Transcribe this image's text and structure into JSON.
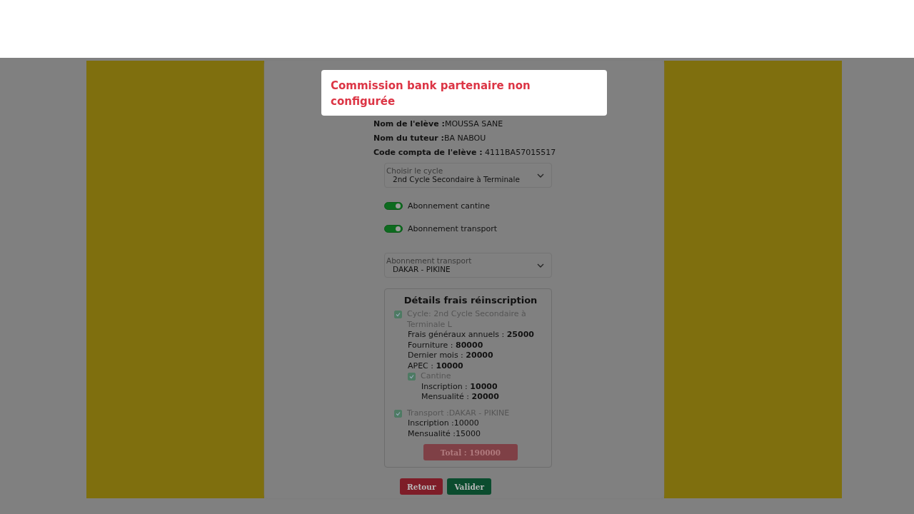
{
  "toast": {
    "message": "Commission bank partenaire non configurée"
  },
  "student_info": [
    {
      "label": "Nom de l'elève :",
      "value": "MOUSSA SANE"
    },
    {
      "label": "Nom du tuteur :",
      "value": "BA NABOU"
    },
    {
      "label": "Code compta de l'elève :",
      "value": " 4111BA57015517"
    }
  ],
  "cycle_select": {
    "label": "Choisir le cycle",
    "value": "2nd Cycle Secondaire à Terminale"
  },
  "toggles": [
    {
      "label": "Abonnement cantine",
      "on": true
    },
    {
      "label": "Abonnement transport",
      "on": true
    }
  ],
  "transport_select": {
    "label": "Abonnement transport",
    "value": "DAKAR - PIKINE"
  },
  "details": {
    "title": "Détails frais réinscription",
    "sections": [
      {
        "label": "Cycle: 2nd Cycle Secondaire à Terminale L",
        "checked": true,
        "lines": [
          "Frais généraux annuels : **25000**",
          "Fourniture : **80000**",
          "Dernier mois : **20000**",
          "APEC : **10000**"
        ],
        "children": [
          {
            "label": "Cantine",
            "checked": true,
            "lines": [
              "Inscription : **10000**",
              "Mensualité : **20000**"
            ]
          }
        ]
      },
      {
        "label": "Transport :DAKAR - PIKINE",
        "checked": true,
        "lines": [
          "Inscription :10000",
          "Mensualité :15000"
        ]
      }
    ],
    "total": "Total : 190000"
  },
  "buttons": [
    {
      "label": "Retour",
      "kind": "cancel"
    },
    {
      "label": "Valider",
      "kind": "confirm"
    }
  ]
}
